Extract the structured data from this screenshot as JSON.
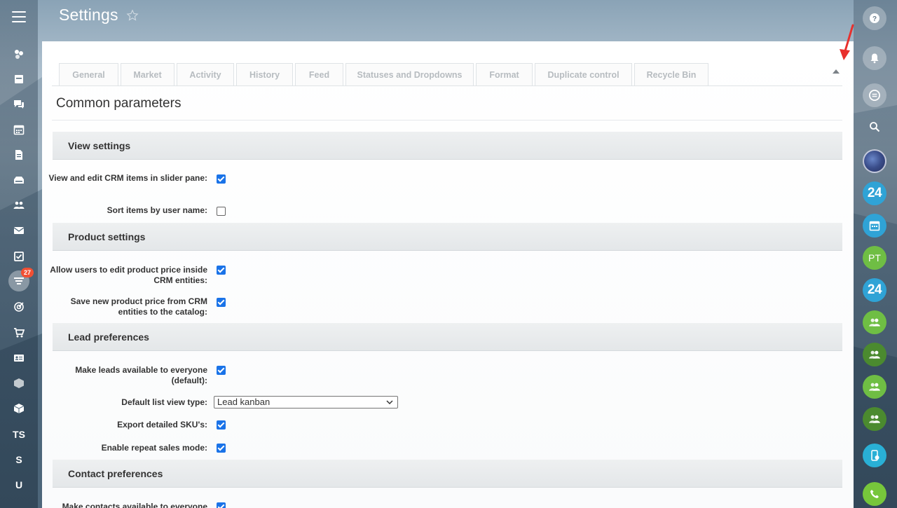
{
  "header": {
    "title": "Settings"
  },
  "left_sidebar": {
    "badge_count": "27",
    "text_items": [
      "TS",
      "S",
      "U"
    ]
  },
  "tabs": [
    {
      "label": "General"
    },
    {
      "label": "Market"
    },
    {
      "label": "Activity"
    },
    {
      "label": "History"
    },
    {
      "label": "Feed"
    },
    {
      "label": "Statuses and Dropdowns"
    },
    {
      "label": "Format"
    },
    {
      "label": "Duplicate control"
    },
    {
      "label": "Recycle Bin"
    }
  ],
  "main": {
    "section_heading": "Common parameters",
    "groups": [
      {
        "title": "View settings",
        "rows": [
          {
            "label": "View and edit CRM items in slider pane:",
            "checked": true
          },
          {
            "label": "Sort items by user name:",
            "checked": false
          }
        ]
      },
      {
        "title": "Product settings",
        "rows": [
          {
            "label": "Allow users to edit product price inside CRM entities:",
            "checked": true
          },
          {
            "label": "Save new product price from CRM entities to the catalog:",
            "checked": true
          }
        ]
      },
      {
        "title": "Lead preferences",
        "rows": [
          {
            "label": "Make leads available to everyone (default):",
            "checked": true
          },
          {
            "label": "Default list view type:",
            "value": "Lead kanban"
          },
          {
            "label": "Export detailed SKU's:",
            "checked": true
          },
          {
            "label": "Enable repeat sales mode:",
            "checked": true
          }
        ]
      },
      {
        "title": "Contact preferences",
        "rows": [
          {
            "label": "Make contacts available to everyone",
            "checked": true
          }
        ]
      }
    ]
  },
  "right_sidebar": {
    "items": [
      {
        "type": "help"
      },
      {
        "type": "bell"
      },
      {
        "type": "chat"
      },
      {
        "type": "search"
      },
      {
        "type": "avatar"
      },
      {
        "type": "b24",
        "text": "24"
      },
      {
        "type": "calendar"
      },
      {
        "type": "initials",
        "text": "PT"
      },
      {
        "type": "b24",
        "text": "24"
      },
      {
        "type": "group"
      },
      {
        "type": "group"
      },
      {
        "type": "group"
      },
      {
        "type": "group"
      },
      {
        "type": "phone-transfer"
      },
      {
        "type": "call"
      }
    ]
  },
  "colors": {
    "accent": "#1a73e8",
    "badge": "#f24f33",
    "annotation_arrow": "#e8302d"
  }
}
